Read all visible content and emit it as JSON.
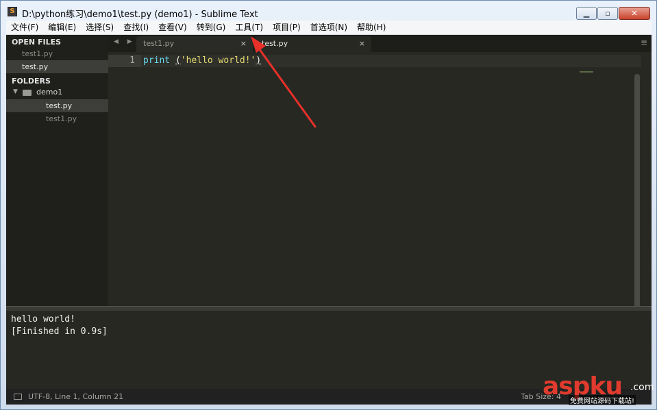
{
  "window": {
    "title": "D:\\python练习\\demo1\\test.py (demo1) - Sublime Text",
    "minimize_glyph": "▁",
    "maximize_glyph": "▫",
    "close_glyph": "✕"
  },
  "menu": [
    "文件(F)",
    "编辑(E)",
    "选择(S)",
    "查找(I)",
    "查看(V)",
    "转到(G)",
    "工具(T)",
    "项目(P)",
    "首选项(N)",
    "帮助(H)"
  ],
  "sidebar": {
    "open_files_header": "OPEN FILES",
    "open_files": [
      "test1.py",
      "test.py"
    ],
    "folders_header": "FOLDERS",
    "folder_name": "demo1",
    "folder_files": [
      "test.py",
      "test1.py"
    ]
  },
  "tabs": {
    "nav_glyphs": "◀ ▶",
    "items": [
      {
        "label": "test1.py",
        "close": "×"
      },
      {
        "label": "test.py",
        "close": "×"
      }
    ],
    "menu_glyph": "≡"
  },
  "editor": {
    "line_number": "1",
    "keyword": "print",
    "space": " ",
    "open_paren": "(",
    "string": "'hello world!'",
    "close_paren": ")"
  },
  "output": {
    "lines": [
      "hello world!",
      "[Finished in 0.9s]"
    ]
  },
  "status": {
    "left": "UTF-8, Line 1, Column 21",
    "right": "Tab Size: 4"
  },
  "watermark": {
    "brand": "aspku",
    "domain": ".com",
    "tagline": "免费网站源码下载站!"
  },
  "colors": {
    "keyword": "#66d9ef",
    "string": "#e6db74",
    "arrow": "#e8302a"
  }
}
